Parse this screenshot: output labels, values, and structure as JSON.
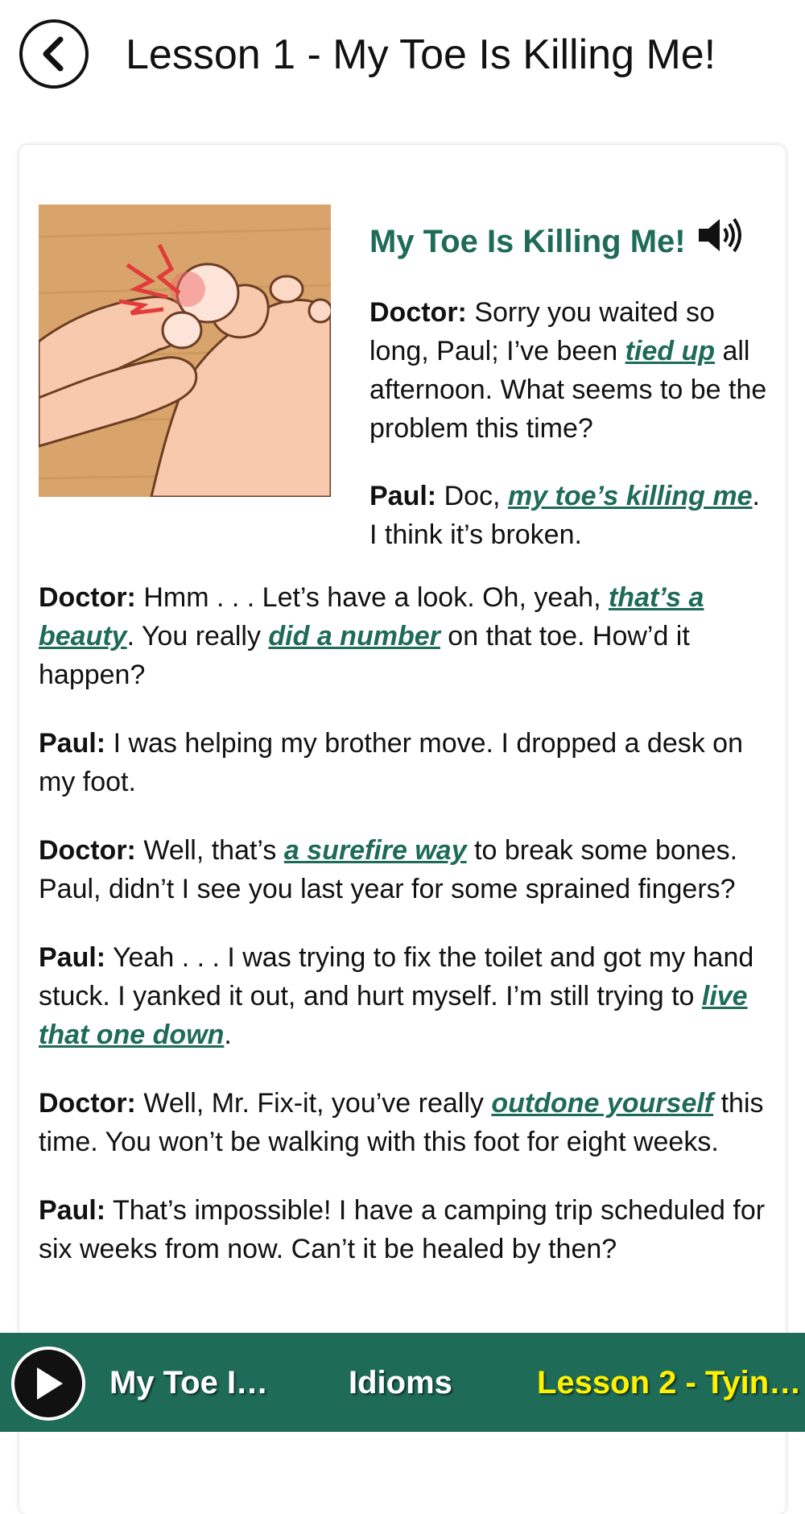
{
  "header": {
    "title": "Lesson 1 - My Toe Is Killing Me!"
  },
  "story": {
    "title": "My Toe Is Killing Me!",
    "intro": [
      {
        "speaker": "Doctor:",
        "t1": " Sorry you waited so long, Paul; I’ve been ",
        "idiom": "tied up",
        "t2": " all afternoon. What seems to be the problem this time?"
      },
      {
        "speaker": "Paul:",
        "t1": " Doc, ",
        "idiom": "my toe’s killing me",
        "t2": ". I think it’s broken."
      }
    ],
    "lines": [
      {
        "speaker": "Doctor:",
        "t1": " Hmm . . . Let’s have a look. Oh, yeah, ",
        "idiom1": "that’s a beauty",
        "t2": ". You really ",
        "idiom2": "did a number",
        "t3": " on that toe. How’d it happen?"
      },
      {
        "speaker": "Paul:",
        "t1": " I was helping my brother move. I dropped a desk on my foot."
      },
      {
        "speaker": "Doctor:",
        "t1": " Well, that’s ",
        "idiom1": "a surefire way",
        "t2": " to break some bones. Paul, didn’t I see you last year for some sprained fingers?"
      },
      {
        "speaker": "Paul:",
        "t1": " Yeah . . . I was trying to fix the toilet and got my hand stuck. I yanked it out, and hurt myself. I’m still trying to ",
        "idiom1": "live that one down",
        "t2": "."
      },
      {
        "speaker": "Doctor:",
        "t1": " Well, Mr. Fix-it, you’ve really ",
        "idiom1": "outdone yourself",
        "t2": " this time. You won’t be walking with this foot for eight weeks."
      },
      {
        "speaker": "Paul:",
        "t1": " That’s impossible! I have a camping trip scheduled for six weeks from now. Can’t it be healed by then?"
      }
    ]
  },
  "bottom_bar": {
    "now_playing": "My Toe I…",
    "idioms": "Idioms",
    "next_lesson": "Lesson 2 - Tyin…"
  },
  "colors": {
    "accent": "#1e6b58",
    "next_lesson_text": "#fff200"
  },
  "icons": [
    "back-chevron-icon",
    "speaker-icon",
    "play-icon"
  ]
}
